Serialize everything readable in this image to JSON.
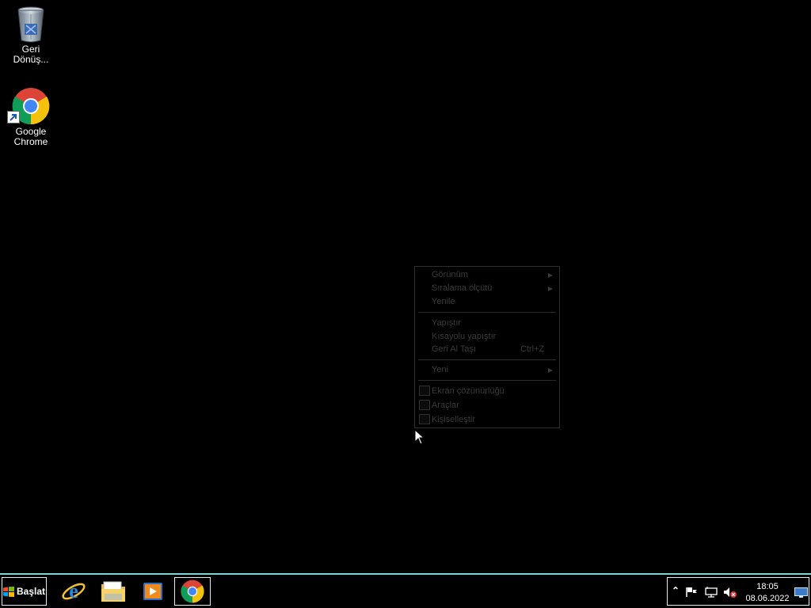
{
  "desktop": {
    "icons": [
      {
        "label": "Geri\nDönüş..."
      },
      {
        "label": "Google\nChrome"
      }
    ]
  },
  "context_menu": {
    "items": [
      {
        "label": "Görünüm",
        "submenu": true
      },
      {
        "label": "Sıralama ölçütü",
        "submenu": true
      },
      {
        "label": "Yenile"
      },
      {
        "label": "Yapıştır"
      },
      {
        "label": "Kısayolu yapıştır"
      },
      {
        "label": "Geri Al Taşı",
        "shortcut": "Ctrl+Z"
      },
      {
        "label": "Yeni",
        "submenu": true
      },
      {
        "label": "Ekran çözünürlüğü",
        "icon": "monitor-icon"
      },
      {
        "label": "Araçlar",
        "icon": "gadgets-icon"
      },
      {
        "label": "Kişiselleştir",
        "icon": "personalize-icon"
      }
    ]
  },
  "taskbar": {
    "start_label": "Başlat",
    "pinned": [
      {
        "icon": "internet-explorer-icon"
      },
      {
        "icon": "file-explorer-icon"
      },
      {
        "icon": "media-player-icon"
      },
      {
        "icon": "google-chrome-icon",
        "active": true
      }
    ],
    "tray": {
      "time": "18:05",
      "date": "08.06.2022",
      "icons": [
        "show-hidden-icons-icon",
        "action-center-flag-icon",
        "network-icon",
        "volume-muted-icon",
        "show-desktop-icon"
      ]
    }
  },
  "colors": {
    "taskbar_border": "#7fd6d6",
    "menu_text": "#3a3a3a"
  }
}
